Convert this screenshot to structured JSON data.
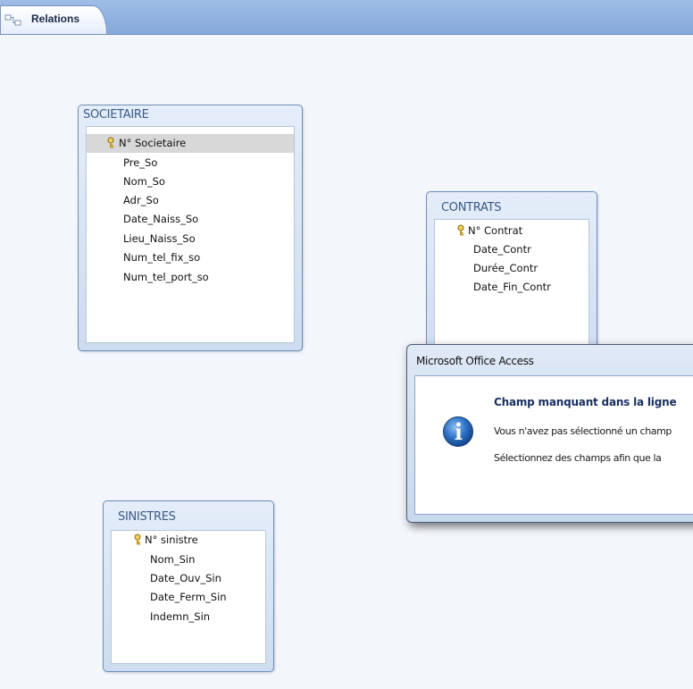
{
  "tabs": {
    "relations_label": "Relations"
  },
  "tables": {
    "societaire": {
      "title": "SOCIETAIRE",
      "fields": [
        "N° Societaire",
        "Pre_So",
        "Nom_So",
        "Adr_So",
        "Date_Naiss_So",
        "Lieu_Naiss_So",
        "Num_tel_fix_so",
        "Num_tel_port_so"
      ]
    },
    "contrats": {
      "title": "CONTRATS",
      "fields": [
        "N° Contrat",
        "Date_Contr",
        "Durée_Contr",
        "Date_Fin_Contr"
      ]
    },
    "sinistres": {
      "title": "SINISTRES",
      "fields": [
        "N° sinistre",
        "Nom_Sin",
        "Date_Ouv_Sin",
        "Date_Ferm_Sin",
        "Indemn_Sin"
      ]
    }
  },
  "dialog": {
    "title": "Microsoft Office Access",
    "heading": "Champ manquant dans la ligne",
    "line1": "Vous n'avez pas sélectionné un champ",
    "line2": "Sélectionnez des champs afin que la"
  },
  "icons": {
    "tab": "relationships-icon",
    "key": "primary-key-icon",
    "info": "information-icon"
  },
  "colors": {
    "tab_strip": "#86a9da",
    "table_header_text": "#3a5a85",
    "primary_key_row": "#d8d8d8",
    "info_icon": "#1f5fb0"
  }
}
